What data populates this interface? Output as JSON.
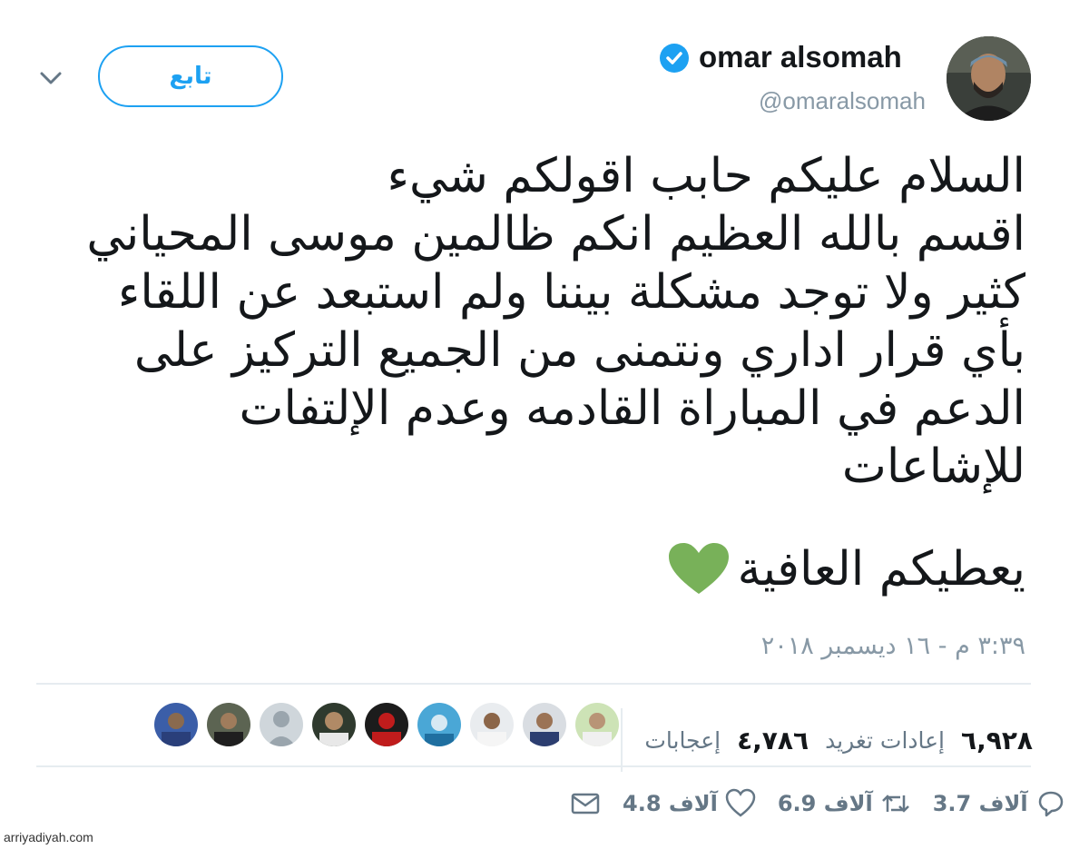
{
  "header": {
    "display_name": "omar alsomah",
    "handle": "@omaralsomah",
    "follow_label": "تابع",
    "verified_icon": "verified-badge-icon",
    "menu_icon": "chevron-down-icon"
  },
  "tweet": {
    "lines": [
      "السلام عليكم حابب اقولكم شيء",
      "اقسم بالله العظيم انكم ظالمين موسى المحياني",
      "كثير ولا توجد مشكلة بيننا ولم استبعد عن اللقاء",
      "بأي قرار اداري ونتمنى من الجميع التركيز على",
      "الدعم في المباراة القادمه وعدم الإلتفات",
      "للإشاعات"
    ],
    "closing": "يعطيكم العافية",
    "closing_icon": "green-heart-icon",
    "timestamp": "٣:٣٩ م - ١٦ ديسمبر ٢٠١٨"
  },
  "stats": {
    "retweets_count": "٦,٩٢٨",
    "retweets_label": "إعادات تغريد",
    "likes_count": "٤,٧٨٦",
    "likes_label": "إعجابات"
  },
  "actions": {
    "reply_count": "3.7 آلاف",
    "retweet_count": "6.9 آلاف",
    "like_count": "4.8 آلاف"
  },
  "colors": {
    "accent": "#1da1f2",
    "secondary_text": "#8899a6",
    "heart_green": "#78b159"
  },
  "watermark": "arriyadiyah.com"
}
